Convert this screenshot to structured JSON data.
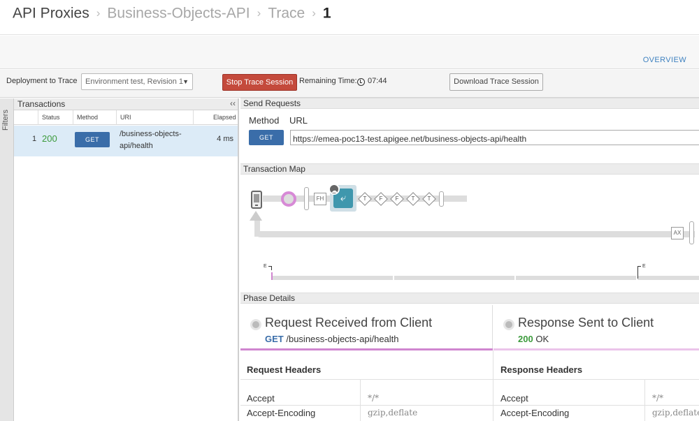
{
  "breadcrumb": {
    "items": [
      "API Proxies",
      "Business-Objects-API",
      "Trace",
      "1"
    ],
    "separator": "›"
  },
  "overview_link": "OVERVIEW",
  "toolbar": {
    "deployment_label": "Deployment to Trace",
    "deployment_value": "Environment test, Revision 1",
    "stop_button": "Stop Trace Session",
    "remaining_label": "Remaining Time:",
    "remaining_value": "07:44",
    "download_button": "Download Trace Session"
  },
  "filters_label": "Filters",
  "transactions": {
    "title": "Transactions",
    "columns": [
      "Status",
      "Method",
      "URI",
      "Elapsed"
    ],
    "rows": [
      {
        "num": "1",
        "status": "200",
        "method": "GET",
        "uri": "/business-objects-api/health",
        "elapsed": "4 ms"
      }
    ]
  },
  "send_requests": {
    "title": "Send Requests",
    "method_label": "Method",
    "url_label": "URL",
    "method": "GET",
    "url": "https://emea-poc13-test.apigee.net/business-objects-api/health"
  },
  "transaction_map": {
    "title": "Transaction Map",
    "nodes": {
      "fh": "FH",
      "ax": "AX",
      "policies": [
        "T",
        "F",
        "F",
        "T",
        "T"
      ]
    },
    "timeline_markers": [
      "E",
      "E"
    ]
  },
  "phase_details": {
    "title": "Phase Details",
    "left": {
      "title": "Request Received from Client",
      "method": "GET",
      "path": "/business-objects-api/health"
    },
    "right": {
      "title": "Response Sent to Client",
      "code": "200",
      "text": "OK"
    }
  },
  "request_headers": {
    "title": "Request Headers",
    "rows": [
      {
        "key": "Accept",
        "value": "*/*"
      },
      {
        "key": "Accept-Encoding",
        "value": "gzip,deflate"
      }
    ]
  },
  "response_headers": {
    "title": "Response Headers",
    "rows": [
      {
        "key": "Accept",
        "value": "*/*"
      },
      {
        "key": "Accept-Encoding",
        "value": "gzip,deflate"
      }
    ]
  },
  "colors": {
    "accent_link": "#3f82c0",
    "stop_red": "#c44a3c",
    "method_blue": "#3a6da9",
    "status_green": "#3c9b3c",
    "row_selected": "#dcebf7",
    "phase_pink": "#d086d0"
  }
}
